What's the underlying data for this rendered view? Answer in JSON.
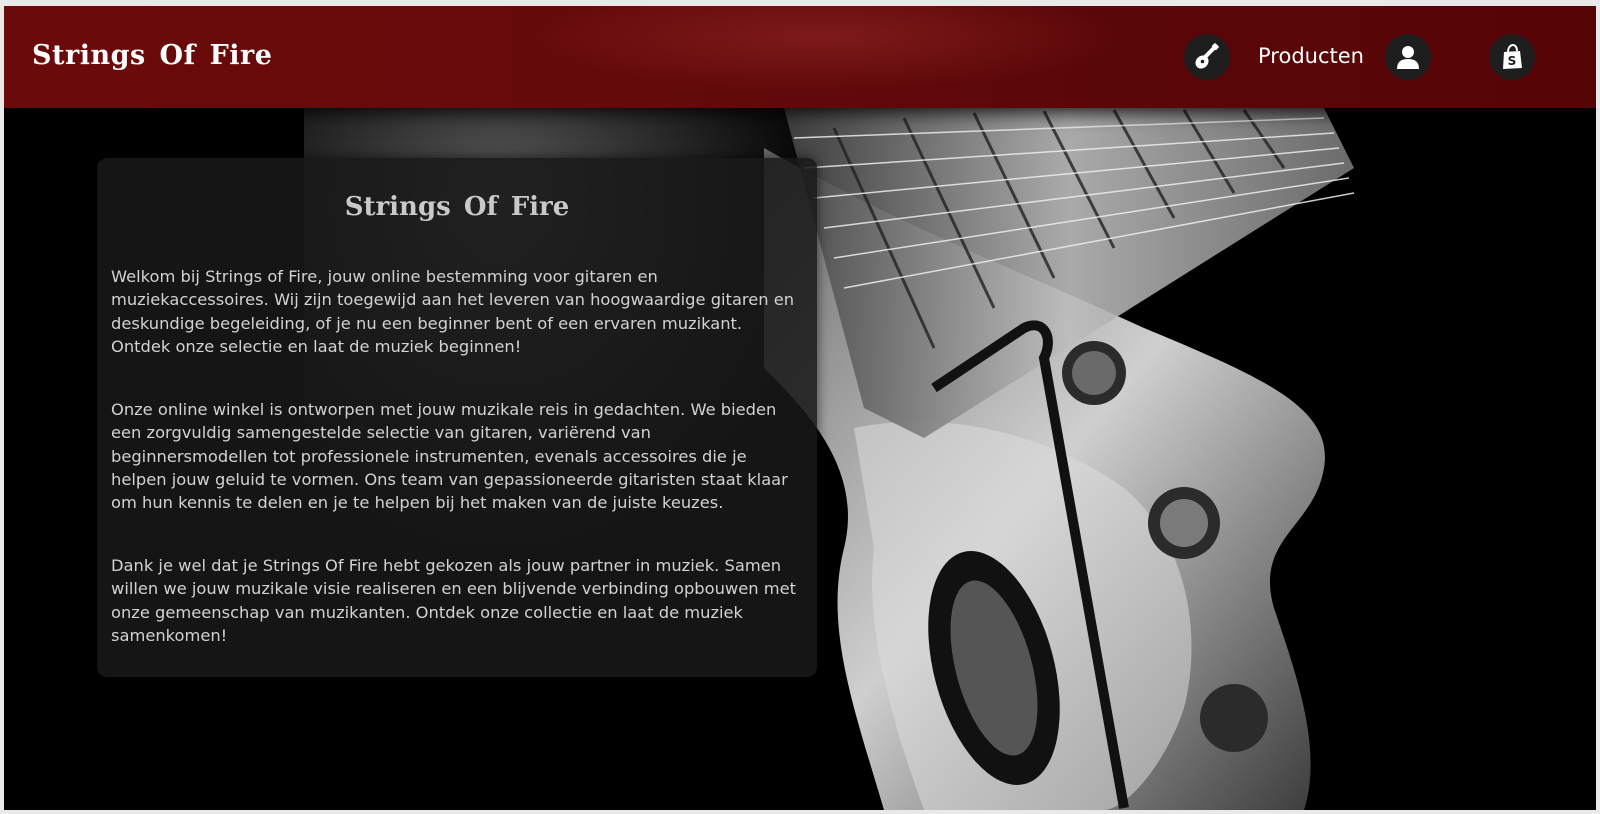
{
  "header": {
    "brand": "Strings Of Fire",
    "nav_products_label": "Producten",
    "icons": [
      "guitar-icon",
      "user-icon",
      "shopping-bag-icon"
    ]
  },
  "card": {
    "title": "Strings Of Fire",
    "paragraphs": [
      "Welkom bij Strings of Fire, jouw online bestemming voor gitaren en muziekaccessoires. Wij zijn toegewijd aan het leveren van hoogwaardige gitaren en deskundige begeleiding, of je nu een beginner bent of een ervaren muzikant. Ontdek onze selectie en laat de muziek beginnen!",
      "Onze online winkel is ontworpen met jouw muzikale reis in gedachten. We bieden een zorgvuldig samengestelde selectie van gitaren, variërend van beginnersmodellen tot professionele instrumenten, evenals accessoires die je helpen jouw geluid te vormen. Ons team van gepassioneerde gitaristen staat klaar om hun kennis te delen en je te helpen bij het maken van de juiste keuzes.",
      "Dank je wel dat je Strings Of Fire hebt gekozen als jouw partner in muziek. Samen willen we jouw muzikale visie realiseren en een blijvende verbinding opbouwen met onze gemeenschap van muzikanten. Ontdek onze collectie en laat de muziek samenkomen!"
    ]
  },
  "colors": {
    "header_bg": "#640a0b",
    "page_bg": "#000000",
    "card_bg": "#181818",
    "text": "#d2d2d2"
  }
}
